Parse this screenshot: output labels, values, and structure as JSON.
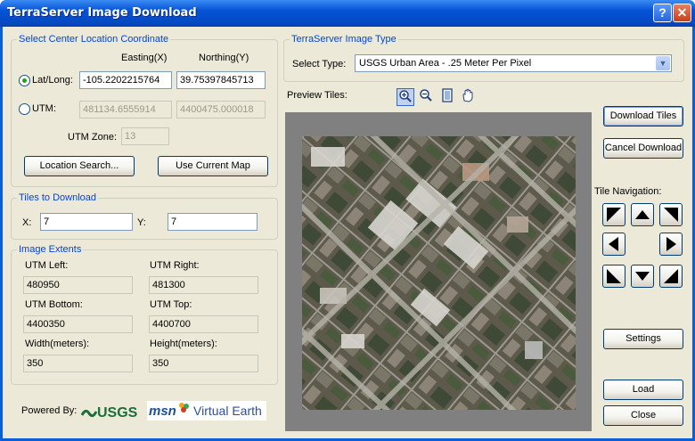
{
  "window": {
    "title": "TerraServer Image Download"
  },
  "center": {
    "group_label": "Select Center Location Coordinate",
    "easting_header": "Easting(X)",
    "northing_header": "Northing(Y)",
    "latlong_label": "Lat/Long:",
    "utm_label": "UTM:",
    "latlong_x": "-105.2202215764",
    "latlong_y": "39.75397845713",
    "utm_x": "481134.6555914",
    "utm_y": "4400475.000018",
    "utm_zone_label": "UTM Zone:",
    "utm_zone": "13",
    "location_search_label": "Location Search...",
    "use_current_map_label": "Use Current Map",
    "selected": "latlong"
  },
  "tiles": {
    "group_label": "Tiles to Download",
    "x_label": "X:",
    "x_value": "7",
    "y_label": "Y:",
    "y_value": "7"
  },
  "extents": {
    "group_label": "Image Extents",
    "utm_left_label": "UTM Left:",
    "utm_left": "480950",
    "utm_right_label": "UTM Right:",
    "utm_right": "481300",
    "utm_bottom_label": "UTM Bottom:",
    "utm_bottom": "4400350",
    "utm_top_label": "UTM Top:",
    "utm_top": "4400700",
    "width_label": "Width(meters):",
    "width": "350",
    "height_label": "Height(meters):",
    "height": "350"
  },
  "footer": {
    "powered_by": "Powered By:",
    "usgs_logo": "USGS",
    "msn_logo_word": "msn",
    "virtual_earth": "Virtual Earth"
  },
  "image_type": {
    "group_label": "TerraServer Image Type",
    "select_label": "Select Type:",
    "selected": "USGS Urban Area - .25 Meter Per Pixel"
  },
  "preview": {
    "label": "Preview Tiles:",
    "tools": [
      "zoom-in-icon",
      "zoom-out-icon",
      "page-icon",
      "hand-pan-icon"
    ]
  },
  "actions": {
    "download_tiles": "Download Tiles",
    "cancel_download": "Cancel Download",
    "tile_navigation": "Tile Navigation:",
    "settings": "Settings",
    "load": "Load",
    "close": "Close"
  },
  "colors": {
    "title_blue": "#0553d6",
    "group_label_blue": "#0046d5",
    "dialog_bg": "#ece9d8"
  }
}
